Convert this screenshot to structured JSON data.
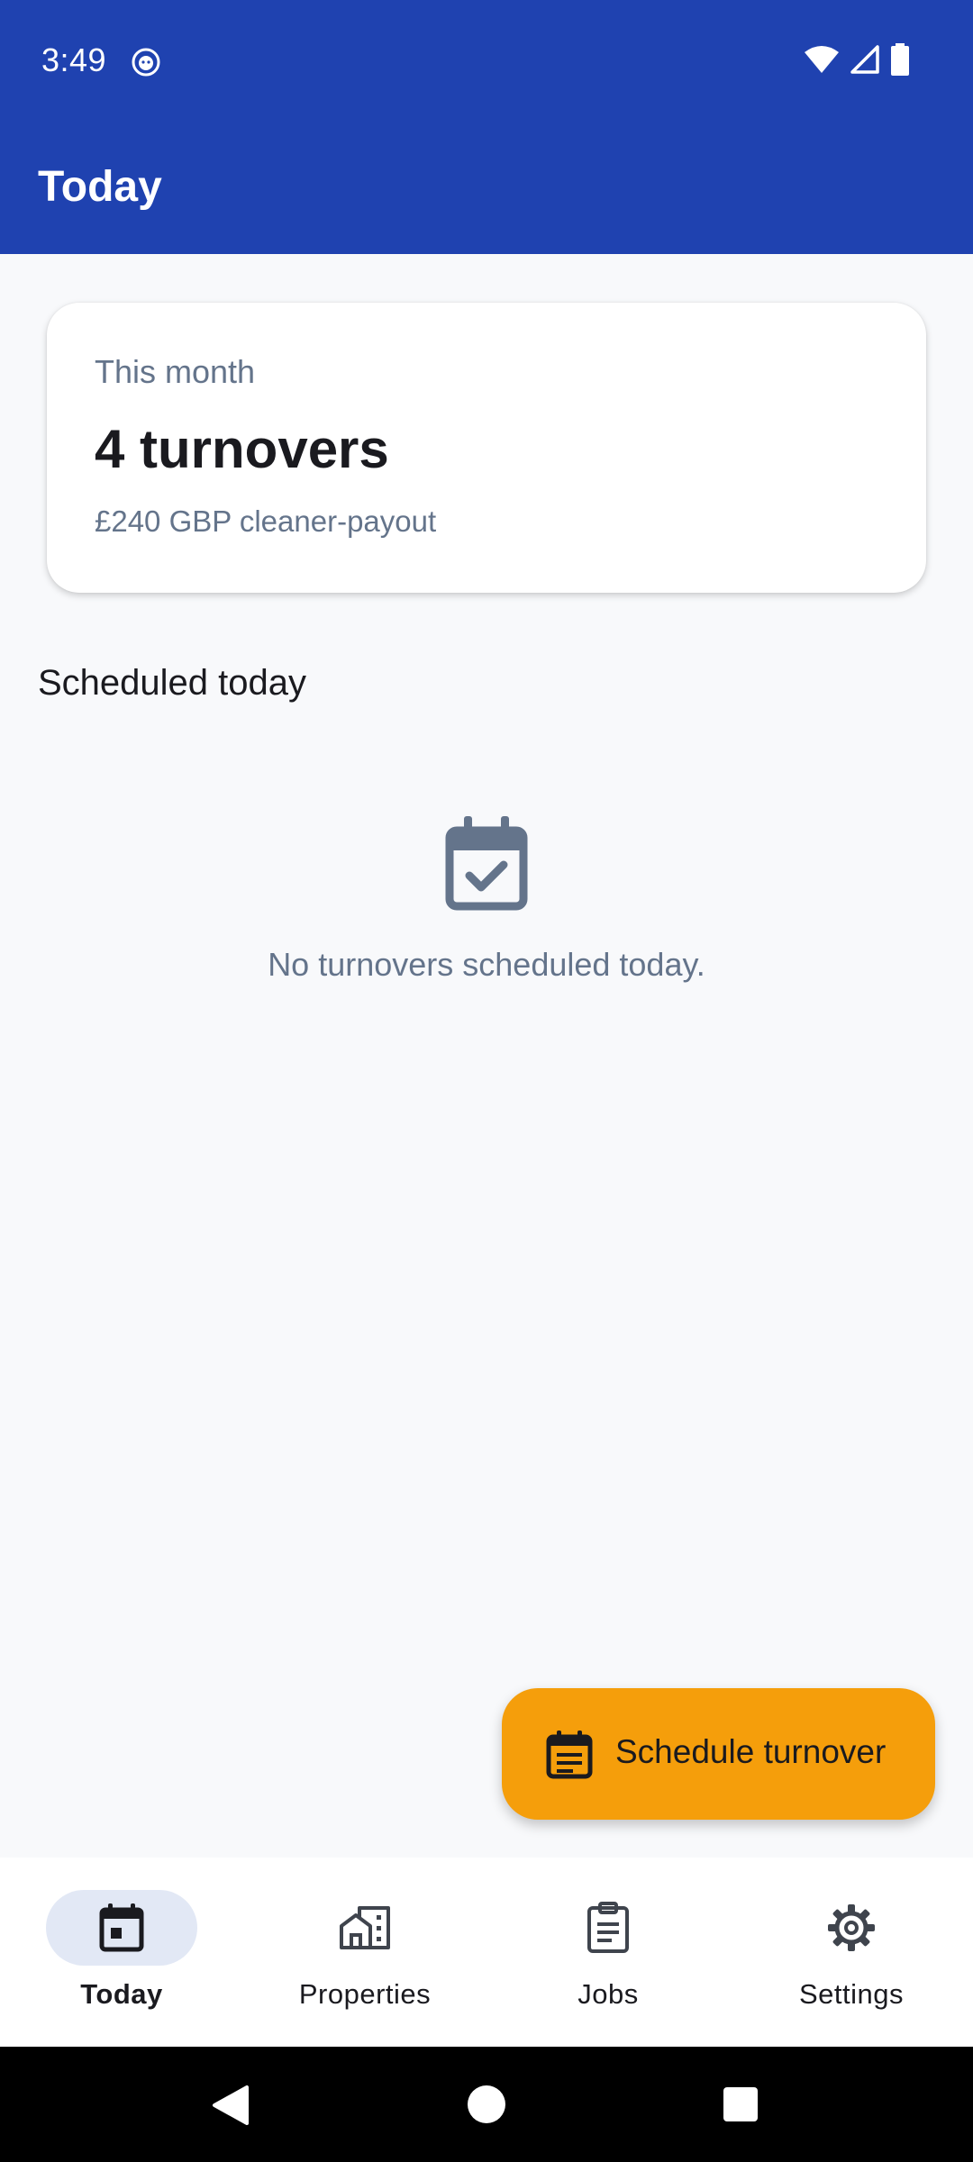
{
  "status_bar": {
    "time": "3:49",
    "app_icon": "cat-face-icon",
    "indicators": [
      "wifi-icon",
      "signal-icon",
      "battery-icon"
    ]
  },
  "app_bar": {
    "title": "Today",
    "background_color": "#1f42b0"
  },
  "summary": {
    "label": "This month",
    "value": "4 turnovers",
    "payout": "£240 GBP cleaner-payout"
  },
  "scheduled": {
    "section_title": "Scheduled today",
    "empty_icon": "calendar-check-icon",
    "empty_text": "No turnovers scheduled today."
  },
  "fab": {
    "label": "Schedule turnover",
    "icon": "calendar-list-icon",
    "color": "#f59e0b"
  },
  "bottom_nav": {
    "items": [
      {
        "label": "Today",
        "icon": "calendar-icon",
        "active": true
      },
      {
        "label": "Properties",
        "icon": "properties-icon",
        "active": false
      },
      {
        "label": "Jobs",
        "icon": "clipboard-icon",
        "active": false
      },
      {
        "label": "Settings",
        "icon": "gear-icon",
        "active": false
      }
    ]
  },
  "system_nav": [
    "back-icon",
    "home-icon",
    "recents-icon"
  ]
}
